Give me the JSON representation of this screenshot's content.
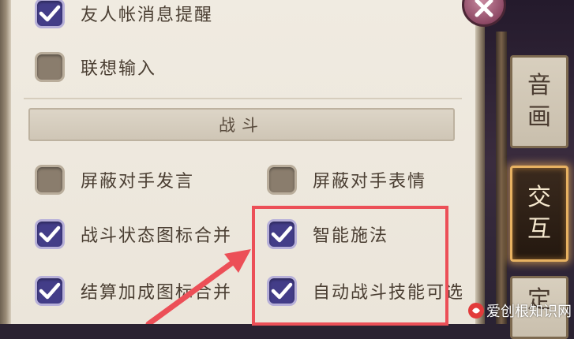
{
  "settings": {
    "items": [
      {
        "label": "友人帐消息提醒",
        "checked": true
      },
      {
        "label": "联想输入",
        "checked": false
      },
      {
        "label": "屏蔽对手发言",
        "checked": false
      },
      {
        "label": "屏蔽对手表情",
        "checked": false
      },
      {
        "label": "战斗状态图标合并",
        "checked": true
      },
      {
        "label": "智能施法",
        "checked": true
      },
      {
        "label": "结算加成图标合并",
        "checked": true
      },
      {
        "label": "自动战斗技能可选",
        "checked": true
      }
    ],
    "section_title": "战斗"
  },
  "tabs": [
    {
      "label_top": "音",
      "label_bottom": "画",
      "active": false
    },
    {
      "label_top": "交",
      "label_bottom": "互",
      "active": true
    },
    {
      "label_top": "定",
      "label_bottom": "",
      "active": false
    }
  ],
  "watermark": {
    "text": "爱创根知识网"
  },
  "colors": {
    "checkbox_on": "#433d88",
    "checkbox_off": "#8a7d6d",
    "highlight": "#ec4f57",
    "active_tab_glow": "#e8b262"
  },
  "icons": {
    "checkmark": "checkmark-icon",
    "close": "close-icon",
    "arrow": "annotation-arrow-icon"
  }
}
